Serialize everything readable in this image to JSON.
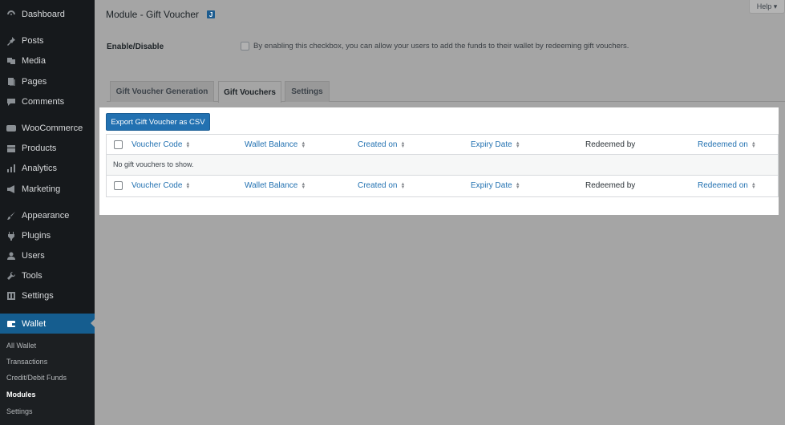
{
  "sidebar": {
    "items": [
      {
        "label": "Dashboard",
        "icon": "dashboard-icon"
      },
      {
        "label": "Posts",
        "icon": "pin-icon"
      },
      {
        "label": "Media",
        "icon": "media-icon"
      },
      {
        "label": "Pages",
        "icon": "pages-icon"
      },
      {
        "label": "Comments",
        "icon": "comments-icon"
      },
      {
        "label": "WooCommerce",
        "icon": "woocommerce-icon"
      },
      {
        "label": "Products",
        "icon": "products-icon"
      },
      {
        "label": "Analytics",
        "icon": "analytics-icon"
      },
      {
        "label": "Marketing",
        "icon": "megaphone-icon"
      },
      {
        "label": "Appearance",
        "icon": "brush-icon"
      },
      {
        "label": "Plugins",
        "icon": "plugin-icon"
      },
      {
        "label": "Users",
        "icon": "users-icon"
      },
      {
        "label": "Tools",
        "icon": "wrench-icon"
      },
      {
        "label": "Settings",
        "icon": "settings-icon"
      },
      {
        "label": "Wallet",
        "icon": "wallet-icon"
      }
    ],
    "submenu": [
      "All Wallet",
      "Transactions",
      "Credit/Debit Funds",
      "Modules",
      "Settings"
    ],
    "current_submenu": "Modules"
  },
  "header": {
    "title": "Module - Gift Voucher",
    "badge": "J",
    "help": "Help ▾"
  },
  "enable": {
    "label": "Enable/Disable",
    "description": "By enabling this checkbox, you can allow your users to add the funds to their wallet by redeeming gift vouchers."
  },
  "tabs": [
    "Gift Voucher Generation",
    "Gift Vouchers",
    "Settings"
  ],
  "active_tab": "Gift Vouchers",
  "table": {
    "export_label": "Export Gift Voucher as CSV",
    "columns": [
      "Voucher Code",
      "Wallet Balance",
      "Created on",
      "Expiry Date",
      "Redeemed by",
      "Redeemed on"
    ],
    "empty_message": "No gift vouchers to show."
  },
  "colors": {
    "accent": "#2271b1",
    "sidebar_bg": "#16191c",
    "active_menu": "#155d8f"
  }
}
